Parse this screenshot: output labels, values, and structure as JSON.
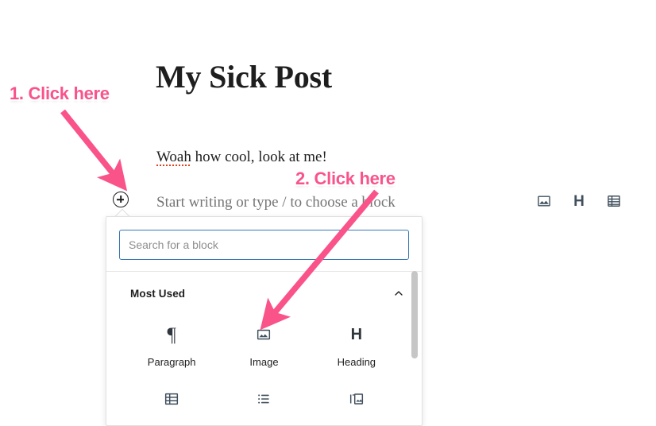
{
  "editor": {
    "post_title": "My Sick Post",
    "paragraph": {
      "misspelled_word": "Woah",
      "rest": " how cool, look at me!"
    },
    "empty_block_placeholder": "Start writing or type / to choose a block",
    "inserter_button_label": "Add block"
  },
  "quick_toolbar": {
    "items": [
      {
        "icon": "image-icon",
        "label": "Image"
      },
      {
        "icon": "heading-icon",
        "label": "H"
      },
      {
        "icon": "table-icon",
        "label": "Table"
      }
    ]
  },
  "inserter_popover": {
    "search": {
      "placeholder": "Search for a block",
      "value": ""
    },
    "section": {
      "title": "Most Used",
      "collapse_icon": "chevron-up-icon"
    },
    "blocks_row_1": [
      {
        "icon": "paragraph-icon",
        "glyph": "¶",
        "label": "Paragraph"
      },
      {
        "icon": "image-icon",
        "label": "Image"
      },
      {
        "icon": "heading-icon",
        "glyph": "H",
        "label": "Heading"
      }
    ],
    "blocks_row_2": [
      {
        "icon": "table-icon",
        "label": ""
      },
      {
        "icon": "list-icon",
        "label": ""
      },
      {
        "icon": "gallery-icon",
        "label": ""
      }
    ]
  },
  "annotations": [
    {
      "id": "anno-1",
      "text": "1. Click here"
    },
    {
      "id": "anno-2",
      "text": "2. Click here"
    }
  ],
  "colors": {
    "annotation_pink": "#f9538a",
    "focus_blue": "#3779b3",
    "icon_slate": "#40505d",
    "text_dark": "#1e1e1e",
    "placeholder_gray": "#757575",
    "spellcheck_red": "#e2401c"
  }
}
